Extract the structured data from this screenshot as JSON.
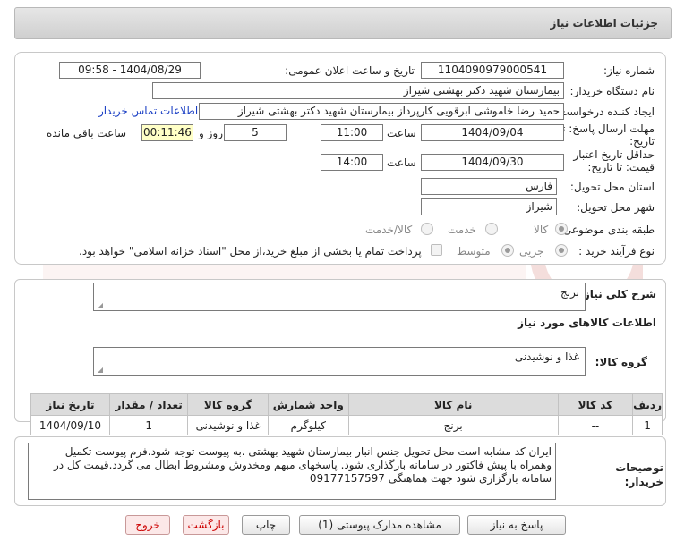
{
  "header": {
    "title": "جزئیات اطلاعات نیاز"
  },
  "fields": {
    "need_number_label": "شماره نیاز:",
    "need_number": "1104090979000541",
    "announce_label": "تاریخ و ساعت اعلان عمومی:",
    "announce_value": "1404/08/29 - 09:58",
    "buyer_label": "نام دستگاه خریدار:",
    "buyer_value": "بیمارستان شهید دکتر بهشتی شیراز",
    "creator_label": "ایجاد کننده درخواست:",
    "creator_value": "حمید رضا خاموشی ابرقویی کارپرداز بیمارستان شهید دکتر بهشتی شیراز",
    "contact_link": "اطلاعات تماس خریدار",
    "deadline_label": "مهلت ارسال پاسخ: تا تاریخ:",
    "deadline_date": "1404/09/04",
    "hour_label": "ساعت",
    "deadline_time": "11:00",
    "days_value": "5",
    "days_label": "روز و",
    "remaining_value": "00:11:46",
    "remaining_label": "ساعت باقی مانده",
    "validity_label": "حداقل تاریخ اعتبار قیمت: تا تاریخ:",
    "validity_date": "1404/09/30",
    "validity_time": "14:00",
    "province_label": "استان محل تحویل:",
    "province_value": "فارس",
    "city_label": "شهر محل تحویل:",
    "city_value": "شیراز",
    "category_label": "طبقه بندی موضوعی:",
    "category_options": [
      "کالا",
      "خدمت",
      "کالا/خدمت"
    ],
    "category_selected": "کالا",
    "process_label": "نوع فرآیند خرید :",
    "process_options": [
      "جزیی",
      "متوسط"
    ],
    "process_selected": "جزیی",
    "payment_note": "پرداخت تمام یا بخشی از مبلغ خرید،از محل \"اسناد خزانه اسلامی\" خواهد بود."
  },
  "needs": {
    "summary_label": "شرح کلی نیاز:",
    "summary_value": "برنج",
    "goods_info_title": "اطلاعات کالاهای مورد نیاز",
    "goods_group_label": "گروه کالا:",
    "goods_group_value": "غذا و نوشیدنی"
  },
  "table": {
    "headers": [
      "ردیف",
      "کد کالا",
      "نام کالا",
      "واحد شمارش",
      "گروه کالا",
      "تعداد / مقدار",
      "تاریخ نیاز"
    ],
    "rows": [
      [
        "1",
        "--",
        "برنج",
        "کیلوگرم",
        "غذا و نوشیدنی",
        "1",
        "1404/09/10"
      ]
    ]
  },
  "description": {
    "label": "توضیحات خریدار:",
    "text": "ایران کد مشابه است محل تحویل جنس انبار بیمارستان شهید بهشتی .به پیوست توجه شود.فرم پیوست تکمیل وهمراه با پیش فاکتور در سامانه بارگذاری شود. پاسخهای مبهم ومخدوش ومشروط ابطال می گردد.قیمت کل در سامانه بارگزاری شود جهت هماهنگی 09177157597"
  },
  "buttons": {
    "reply": "پاسخ به نیاز",
    "attachments": "مشاهده مدارک پیوستی (1)",
    "print": "چاپ",
    "back": "بازگشت",
    "exit": "خروج"
  },
  "colors": {
    "link": "#1a3fc4",
    "remaining_bg": "#ffffc6",
    "exit_text": "#cc0000"
  }
}
